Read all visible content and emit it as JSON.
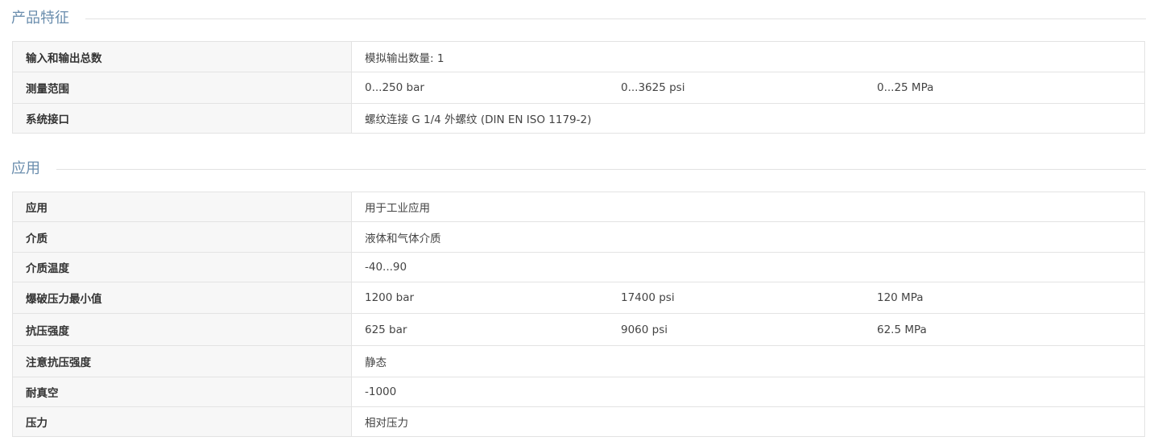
{
  "sections": [
    {
      "title": "产品特征",
      "rows": [
        {
          "label": "输入和输出总数",
          "values": [
            "模拟输出数量: 1"
          ]
        },
        {
          "label": "测量范围",
          "values": [
            "0...250 bar",
            "0...3625 psi",
            "0...25 MPa"
          ]
        },
        {
          "label": "系统接口",
          "values": [
            "螺纹连接 G 1/4 外螺纹 (DIN EN ISO 1179-2)"
          ]
        }
      ]
    },
    {
      "title": "应用",
      "rows": [
        {
          "label": "应用",
          "values": [
            "用于工业应用"
          ]
        },
        {
          "label": "介质",
          "values": [
            "液体和气体介质"
          ]
        },
        {
          "label": "介质温度",
          "values": [
            "-40...90"
          ]
        },
        {
          "label": "爆破压力最小值",
          "values": [
            "1200 bar",
            "17400 psi",
            "120 MPa"
          ]
        },
        {
          "label": "抗压强度",
          "values": [
            "625 bar",
            "9060 psi",
            "62.5 MPa"
          ]
        },
        {
          "label": "注意抗压强度",
          "values": [
            "静态"
          ]
        },
        {
          "label": "耐真空",
          "values": [
            "-1000"
          ]
        },
        {
          "label": "压力",
          "values": [
            "相对压力"
          ]
        }
      ]
    }
  ]
}
